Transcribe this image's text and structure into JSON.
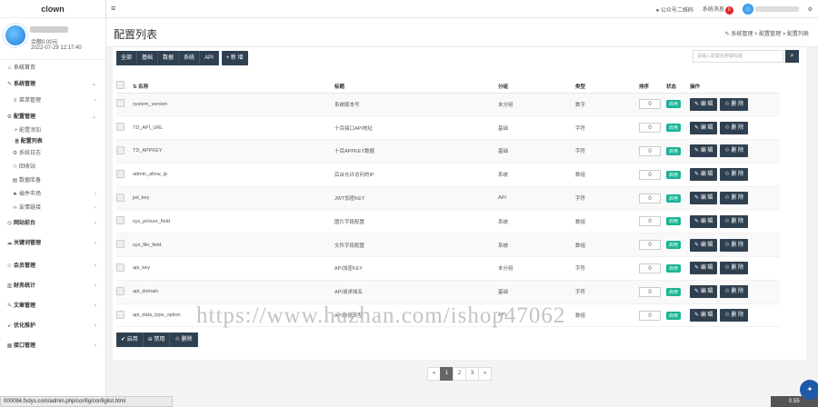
{
  "app": {
    "brand": "clown"
  },
  "profile": {
    "balance": "余额0.00元",
    "date": "2022-07-29 12:17:40"
  },
  "sidebar": {
    "items": [
      {
        "label": "系统首页",
        "icon": "home-icon"
      },
      {
        "label": "系统管理",
        "icon": "wrench-icon",
        "bold": true
      },
      {
        "label": "菜单管理",
        "icon": "list-icon"
      },
      {
        "label": "配置管理",
        "icon": "gear-icon",
        "bold": true
      },
      {
        "label": "+ 配置添加",
        "sub": true
      },
      {
        "label": "配置列表",
        "sub": true,
        "active": true
      },
      {
        "label": "系统日志",
        "icon": "log-icon"
      },
      {
        "label": "回收站",
        "icon": "trash-icon"
      },
      {
        "label": "数据库备",
        "icon": "db-icon"
      },
      {
        "label": "插件市场",
        "icon": "plugin-icon"
      },
      {
        "label": "友情链接",
        "icon": "link-icon"
      },
      {
        "label": "网站前台",
        "icon": "globe-icon"
      },
      {
        "label": "关键词管理",
        "icon": "cloud-icon"
      },
      {
        "label": "会员管理",
        "icon": "users-icon"
      },
      {
        "label": "财务统计",
        "icon": "chart-icon"
      },
      {
        "label": "文章管理",
        "icon": "edit-icon"
      },
      {
        "label": "优化推护",
        "icon": "rocket-icon"
      },
      {
        "label": "接口管理",
        "icon": "api-icon"
      }
    ]
  },
  "topbar": {
    "qrcode": "公众号二维码",
    "messages": "系统消息",
    "message_count": "0"
  },
  "page": {
    "title": "配置列表",
    "breadcrumb": "系统管理 > 配置管理 > 配置列表"
  },
  "filters": [
    "全部",
    "基础",
    "数据",
    "系统",
    "API"
  ],
  "new_button": "新 增",
  "search": {
    "placeholder": "请输入配置名称或标题"
  },
  "table": {
    "headers": {
      "name": "名称",
      "title": "标题",
      "group": "分组",
      "type": "类型",
      "sort": "排序",
      "status": "状态",
      "ops": "操作"
    },
    "rows": [
      {
        "name": "system_version",
        "title": "系统版本号",
        "group": "未分组",
        "type": "数字",
        "sort": "0",
        "status": "启用"
      },
      {
        "name": "TD_API_URL",
        "title": "十百接口API地址",
        "group": "基础",
        "type": "字符",
        "sort": "0",
        "status": "启用"
      },
      {
        "name": "TD_APPKEY",
        "title": "十百APPKEY数据",
        "group": "基础",
        "type": "字符",
        "sort": "0",
        "status": "启用"
      },
      {
        "name": "admin_allow_ip",
        "title": "后台允许访问的IP",
        "group": "系统",
        "type": "数组",
        "sort": "0",
        "status": "启用"
      },
      {
        "name": "jwt_key",
        "title": "JWT加密KEY",
        "group": "API",
        "type": "字符",
        "sort": "0",
        "status": "启用"
      },
      {
        "name": "sys_picture_field",
        "title": "图片字段配置",
        "group": "系统",
        "type": "数组",
        "sort": "0",
        "status": "启用"
      },
      {
        "name": "sys_file_field",
        "title": "文件字段配置",
        "group": "系统",
        "type": "数组",
        "sort": "0",
        "status": "启用"
      },
      {
        "name": "api_key",
        "title": "API加密KEY",
        "group": "未分组",
        "type": "字符",
        "sort": "0",
        "status": "启用"
      },
      {
        "name": "api_domain",
        "title": "API请求域名",
        "group": "基础",
        "type": "字符",
        "sort": "0",
        "status": "启用"
      },
      {
        "name": "api_data_type_option",
        "title": "API数据类型",
        "group": "API",
        "type": "数组",
        "sort": "0",
        "status": "启用"
      }
    ],
    "edit_label": "编 辑",
    "delete_label": "删 除"
  },
  "bulk": {
    "enable": "启用",
    "disable": "禁用",
    "delete": "删除"
  },
  "pager": [
    "«",
    "1",
    "2",
    "3",
    "»"
  ],
  "status_url": "000084.fxdys.com/admin.php/config/configlist.html",
  "watermark": "https://www.huzhan.com/ishop47062",
  "speed": "0.55"
}
